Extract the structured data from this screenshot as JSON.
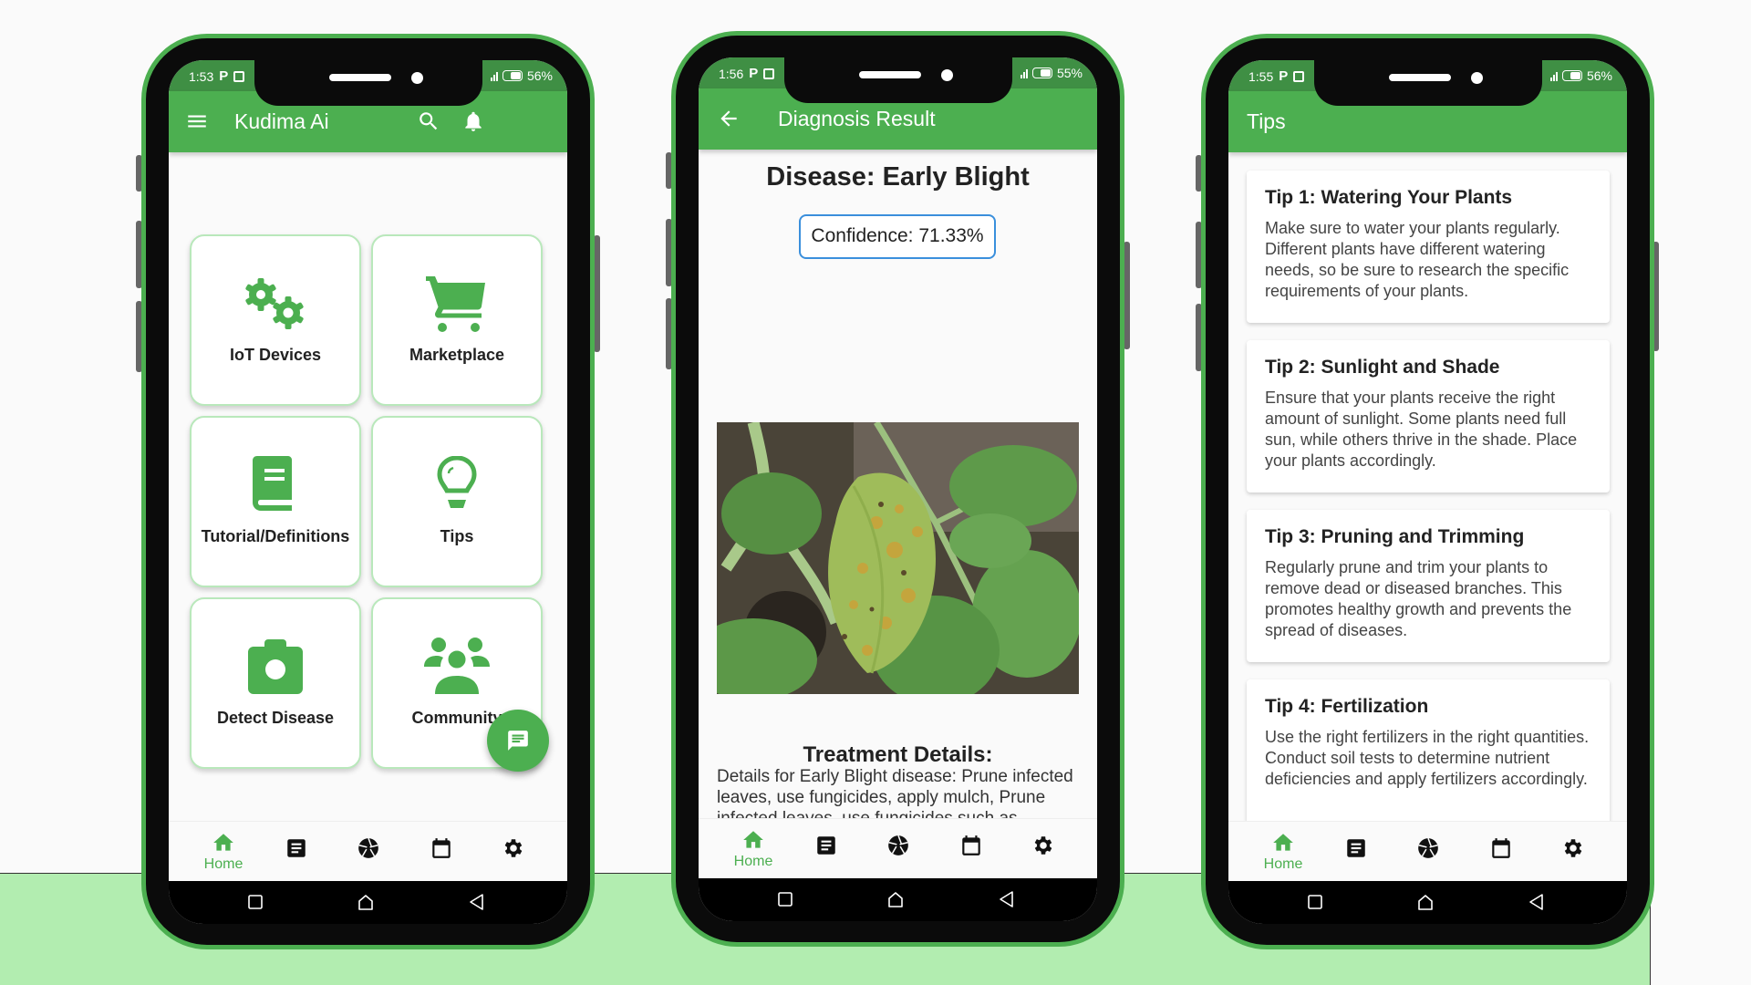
{
  "colors": {
    "primary": "#4caf50",
    "status_bar": "#3f8f44",
    "band": "#b2edb0",
    "confidence_border": "#3a8fdc",
    "text_dark": "#222222"
  },
  "phones": [
    {
      "status": {
        "time": "1:53",
        "battery": "56%"
      },
      "appbar": {
        "title": "Kudima Ai",
        "left_icon": "menu-icon",
        "right_icons": [
          "search-icon",
          "notifications-icon"
        ]
      },
      "tiles": [
        {
          "label": "IoT Devices",
          "icon": "gears-icon"
        },
        {
          "label": "Marketplace",
          "icon": "cart-icon"
        },
        {
          "label": "Tutorial/Definitions",
          "icon": "book-icon"
        },
        {
          "label": "Tips",
          "icon": "lightbulb-icon"
        },
        {
          "label": "Detect Disease",
          "icon": "camera-icon"
        },
        {
          "label": "Community",
          "icon": "people-icon"
        }
      ],
      "fab_icon": "chat-icon"
    },
    {
      "status": {
        "time": "1:56",
        "battery": "55%"
      },
      "appbar": {
        "title": "Diagnosis Result",
        "left_icon": "back-arrow-icon"
      },
      "disease_title": "Disease: Early Blight",
      "confidence": "Confidence: 71.33%",
      "image_alt": "tomato leaf with early blight spots",
      "treatment_title": "Treatment Details:",
      "treatment_body": "Details for Early Blight disease: Prune infected leaves, use fungicides, apply mulch, Prune infected leaves, use fungicides such as"
    },
    {
      "status": {
        "time": "1:55",
        "battery": "56%"
      },
      "appbar": {
        "title": "Tips"
      },
      "tips": [
        {
          "title": "Tip 1: Watering Your Plants",
          "body": "Make sure to water your plants regularly. Different plants have different watering needs, so be sure to research the specific requirements of your plants."
        },
        {
          "title": "Tip 2: Sunlight and Shade",
          "body": "Ensure that your plants receive the right amount of sunlight. Some plants need full sun, while others thrive in the shade. Place your plants accordingly."
        },
        {
          "title": "Tip 3: Pruning and Trimming",
          "body": "Regularly prune and trim your plants to remove dead or diseased branches. This promotes healthy growth and prevents the spread of diseases."
        },
        {
          "title": "Tip 4: Fertilization",
          "body": "Use the right fertilizers in the right quantities. Conduct soil tests to determine nutrient deficiencies and apply fertilizers accordingly."
        }
      ]
    }
  ],
  "bottom_nav": {
    "items": [
      {
        "label": "Home",
        "icon": "home-icon",
        "active": true
      },
      {
        "label": "",
        "icon": "article-icon"
      },
      {
        "label": "",
        "icon": "shutter-icon"
      },
      {
        "label": "",
        "icon": "calendar-icon"
      },
      {
        "label": "",
        "icon": "settings-icon"
      }
    ]
  },
  "system_nav": [
    "recents-icon",
    "home-outline-icon",
    "back-triangle-icon"
  ]
}
